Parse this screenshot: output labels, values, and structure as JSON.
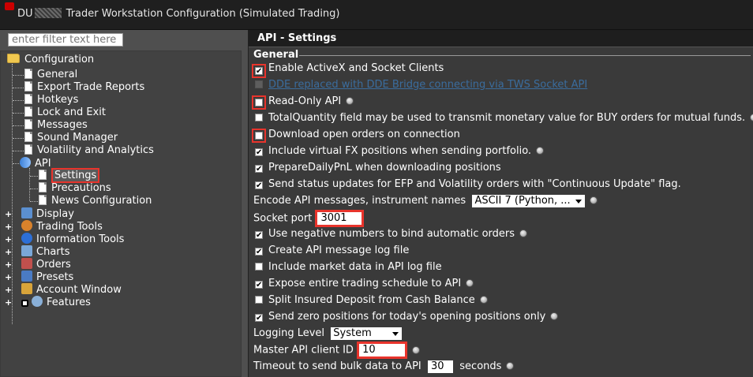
{
  "window": {
    "title_prefix": "DU",
    "title_suffix": "Trader Workstation Configuration (Simulated Trading)"
  },
  "filter": {
    "placeholder": "enter filter text here"
  },
  "tree": {
    "root": "Configuration",
    "children": [
      "General",
      "Export Trade Reports",
      "Hotkeys",
      "Lock and Exit",
      "Messages",
      "Sound Manager",
      "Volatility and Analytics"
    ],
    "api": {
      "label": "API",
      "children": [
        "Settings",
        "Precautions",
        "News Configuration"
      ]
    },
    "groups": [
      "Display",
      "Trading Tools",
      "Information Tools",
      "Charts",
      "Orders",
      "Presets",
      "Account Window",
      "Features"
    ]
  },
  "panel": {
    "header": "API - Settings",
    "section": "General",
    "options": {
      "activex": {
        "label": "Enable ActiveX and Socket Clients",
        "checked": true
      },
      "dde": {
        "label": "DDE replaced with DDE Bridge connecting via TWS Socket API",
        "checked": false
      },
      "readonly": {
        "label": "Read-Only API",
        "checked": false
      },
      "totalqty": {
        "label": "TotalQuantity field may be used to transmit monetary value for BUY orders for mutual funds.",
        "checked": false
      },
      "download": {
        "label": "Download open orders on connection",
        "checked": false
      },
      "virtualfx": {
        "label": "Include virtual FX positions when sending portfolio.",
        "checked": true
      },
      "dailypnl": {
        "label": "PrepareDailyPnL when downloading positions",
        "checked": true
      },
      "status": {
        "label": "Send status updates for EFP and Volatility orders with \"Continuous Update\" flag.",
        "checked": true
      },
      "negative": {
        "label": "Use negative numbers to bind automatic orders",
        "checked": true
      },
      "logfile": {
        "label": "Create API message log file",
        "checked": true
      },
      "marketdata": {
        "label": "Include market data in API log file",
        "checked": false
      },
      "schedule": {
        "label": "Expose entire trading schedule to API",
        "checked": true
      },
      "insured": {
        "label": "Split Insured Deposit from Cash Balance",
        "checked": false
      },
      "zeropos": {
        "label": "Send zero positions for today's opening positions only",
        "checked": true
      }
    },
    "encode": {
      "label": "Encode API messages, instrument names",
      "value": "ASCII 7 (Python, ..."
    },
    "socket": {
      "label": "Socket port",
      "value": "3001"
    },
    "logging": {
      "label": "Logging Level",
      "value": "System"
    },
    "clientid": {
      "label": "Master API client ID",
      "value": "10"
    },
    "timeout": {
      "label": "Timeout to send bulk data to API",
      "value": "30",
      "unit": "seconds"
    }
  },
  "colors": {
    "highlight": "#e8342c",
    "link": "#3a8ee0",
    "panel_bg": "#3a3a3a",
    "tree_bg": "#424242"
  }
}
